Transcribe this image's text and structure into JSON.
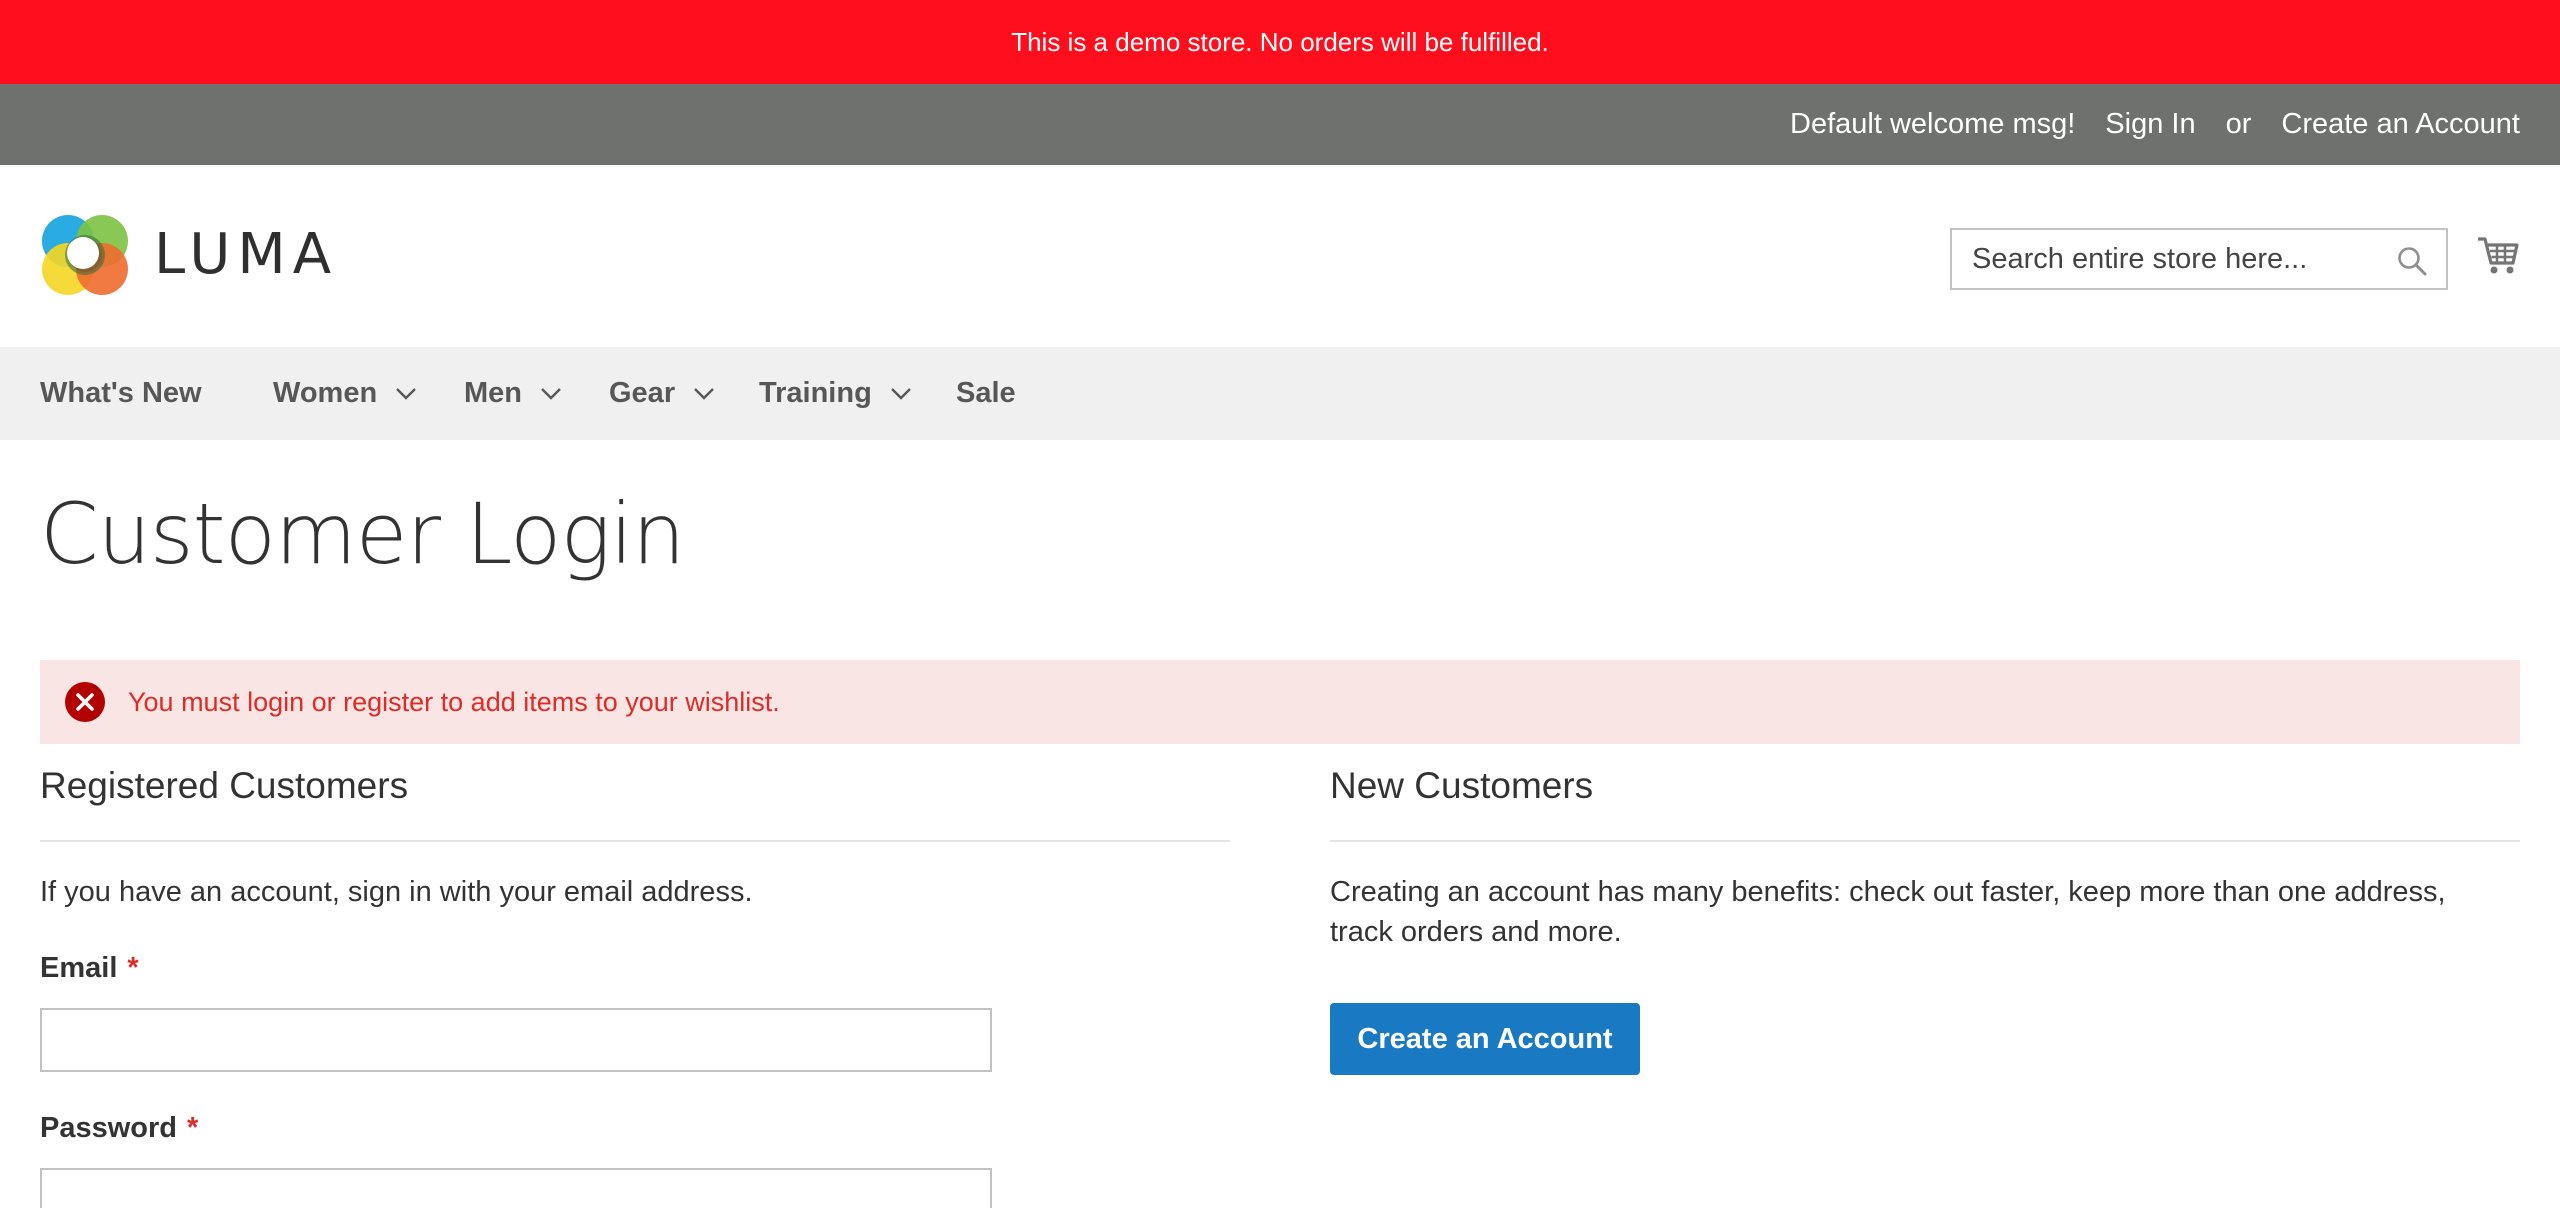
{
  "demo_notice": "This is a demo store. No orders will be fulfilled.",
  "top_bar": {
    "welcome": "Default welcome msg!",
    "sign_in": "Sign In",
    "or": "or",
    "create_account": "Create an Account"
  },
  "header": {
    "logo_text": "LUMA",
    "search_placeholder": "Search entire store here..."
  },
  "nav": {
    "items": [
      {
        "label": "What's New",
        "has_dropdown": false
      },
      {
        "label": "Women",
        "has_dropdown": true
      },
      {
        "label": "Men",
        "has_dropdown": true
      },
      {
        "label": "Gear",
        "has_dropdown": true
      },
      {
        "label": "Training",
        "has_dropdown": true
      },
      {
        "label": "Sale",
        "has_dropdown": false
      }
    ]
  },
  "page_title": "Customer Login",
  "error_message": "You must login or register to add items to your wishlist.",
  "registered": {
    "title": "Registered Customers",
    "intro": "If you have an account, sign in with your email address.",
    "email_label": "Email",
    "password_label": "Password",
    "required_mark": "*"
  },
  "new_customers": {
    "title": "New Customers",
    "intro": "Creating an account has many benefits: check out faster, keep more than one address, track orders and more.",
    "button_label": "Create an Account"
  },
  "colors": {
    "demo_notice_bg": "#ff0f1e",
    "top_bar_bg": "#6e716e",
    "nav_bg": "#f0f0f0",
    "error_bg": "#fae5e5",
    "error_text": "#e02b27",
    "primary_button": "#1979c3"
  },
  "icons": [
    "luma-logo-icon",
    "search-icon",
    "cart-icon",
    "chevron-down-icon",
    "error-icon"
  ]
}
